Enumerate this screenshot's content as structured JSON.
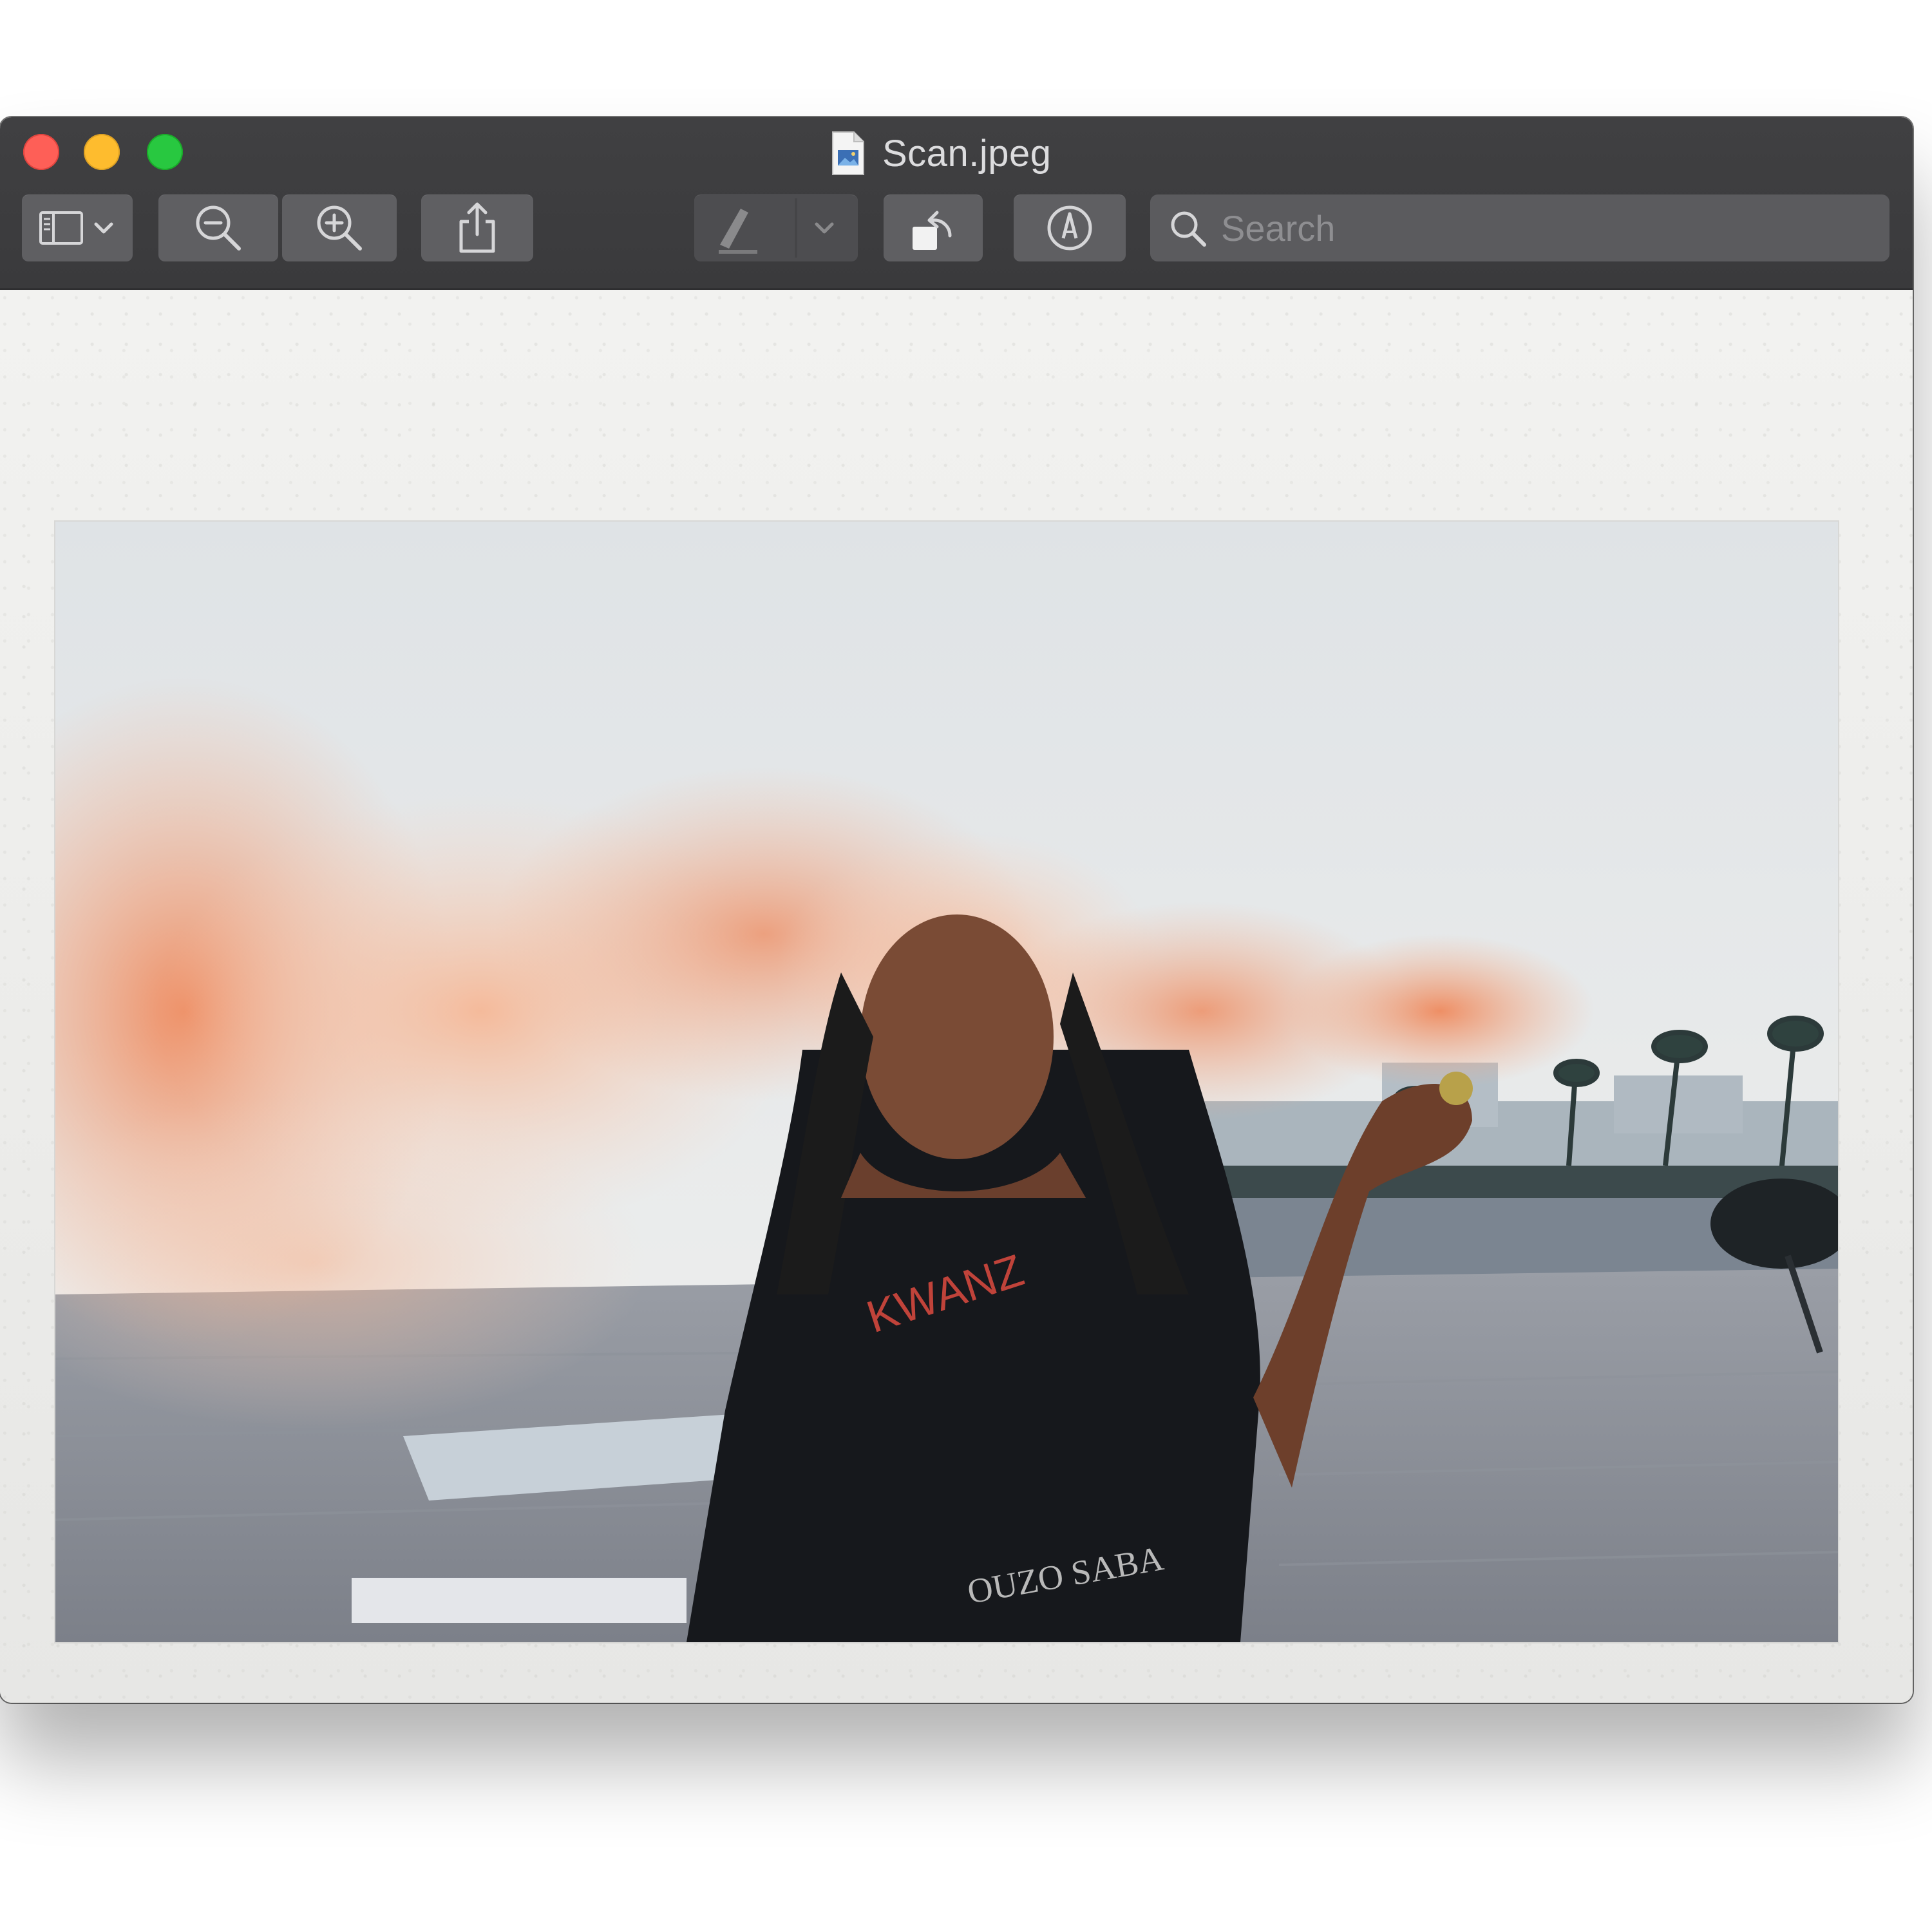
{
  "window": {
    "title": "Scan.jpeg",
    "traffic_lights": {
      "close": "#fe5f57",
      "minimize": "#febc2e",
      "zoom": "#28c840"
    }
  },
  "toolbar": {
    "sidebar_button": {
      "icon": "sidebar-icon",
      "dropdown_icon": "chevron-down-icon"
    },
    "zoom_out_button": {
      "icon": "zoom-out-icon"
    },
    "zoom_in_button": {
      "icon": "zoom-in-icon"
    },
    "share_button": {
      "icon": "share-icon"
    },
    "highlight_button": {
      "icon": "highlighter-icon",
      "dropdown_icon": "chevron-down-icon",
      "enabled": false
    },
    "rotate_button": {
      "icon": "rotate-left-icon"
    },
    "markup_button": {
      "icon": "markup-pen-icon"
    },
    "search": {
      "placeholder": "Search",
      "value": ""
    }
  },
  "document": {
    "photo": {
      "shirt_print_top": "KWANZ",
      "shirt_print_bottom": "OUZO SABA"
    }
  },
  "colors": {
    "toolbar_bg": "#3c3c3e",
    "button_bg": "#5f5f62",
    "title_text": "#dcdcde",
    "smoke": "#ee8a5e"
  }
}
